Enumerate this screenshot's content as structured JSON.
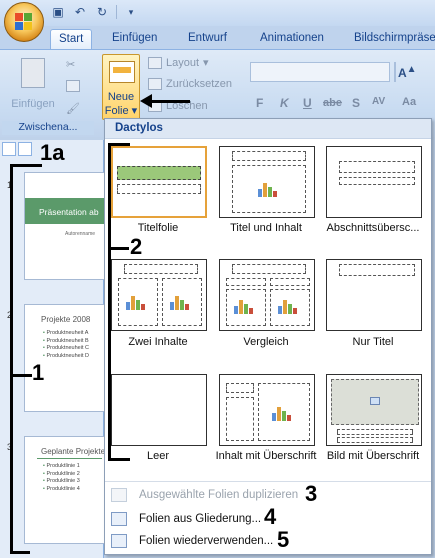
{
  "quick_access": {
    "save_icon": "save-icon",
    "undo_icon": "undo-icon",
    "redo_icon": "redo-icon"
  },
  "tabs": [
    {
      "label": "Start",
      "active": true
    },
    {
      "label": "Einfügen"
    },
    {
      "label": "Entwurf"
    },
    {
      "label": "Animationen"
    },
    {
      "label": "Bildschirmpräse"
    }
  ],
  "ribbon": {
    "paste_label": "Einfügen",
    "clipboard_group_label": "Zwischena...",
    "new_slide_label_line1": "Neue",
    "new_slide_label_line2": "Folie",
    "layout_label": "Layout",
    "reset_label": "Zurücksetzen",
    "delete_label": "Löschen",
    "font_buttons": [
      "F",
      "K",
      "U",
      "abe",
      "S",
      "AV",
      "Aa"
    ]
  },
  "slide_pane": {
    "slides": [
      {
        "number": "1",
        "title": "Präsentation ab",
        "subtitle": "Autorenname"
      },
      {
        "number": "2",
        "title": "Projekte 2008",
        "items": [
          "Produktneuheit A",
          "Produktneuheit B",
          "Produktneuheit C",
          "Produktneuheit D"
        ]
      },
      {
        "number": "3",
        "title": "Geplante Projekte",
        "items": [
          "Produktlinie 1",
          "Produktlinie 2",
          "Produktlinie 3",
          "Produktlinie 4"
        ]
      }
    ]
  },
  "gallery": {
    "theme_name": "Dactylos",
    "layouts": [
      {
        "caption": "Titelfolie",
        "selected": true
      },
      {
        "caption": "Titel und Inhalt"
      },
      {
        "caption": "Abschnittsübersc..."
      },
      {
        "caption": "Zwei Inhalte"
      },
      {
        "caption": "Vergleich"
      },
      {
        "caption": "Nur Titel"
      },
      {
        "caption": "Leer"
      },
      {
        "caption": "Inhalt mit Überschrift"
      },
      {
        "caption": "Bild mit Überschrift"
      }
    ],
    "menu": [
      {
        "label": "Ausgewählte Folien duplizieren",
        "disabled": true
      },
      {
        "label": "Folien aus Gliederung..."
      },
      {
        "label": "Folien wiederverwenden..."
      }
    ]
  },
  "annotations": [
    "1a",
    "1",
    "2",
    "3",
    "4",
    "5"
  ],
  "colors": {
    "accent": "#15428b",
    "selected_border": "#e6a23a",
    "slide_green": "#5b9a6a"
  }
}
